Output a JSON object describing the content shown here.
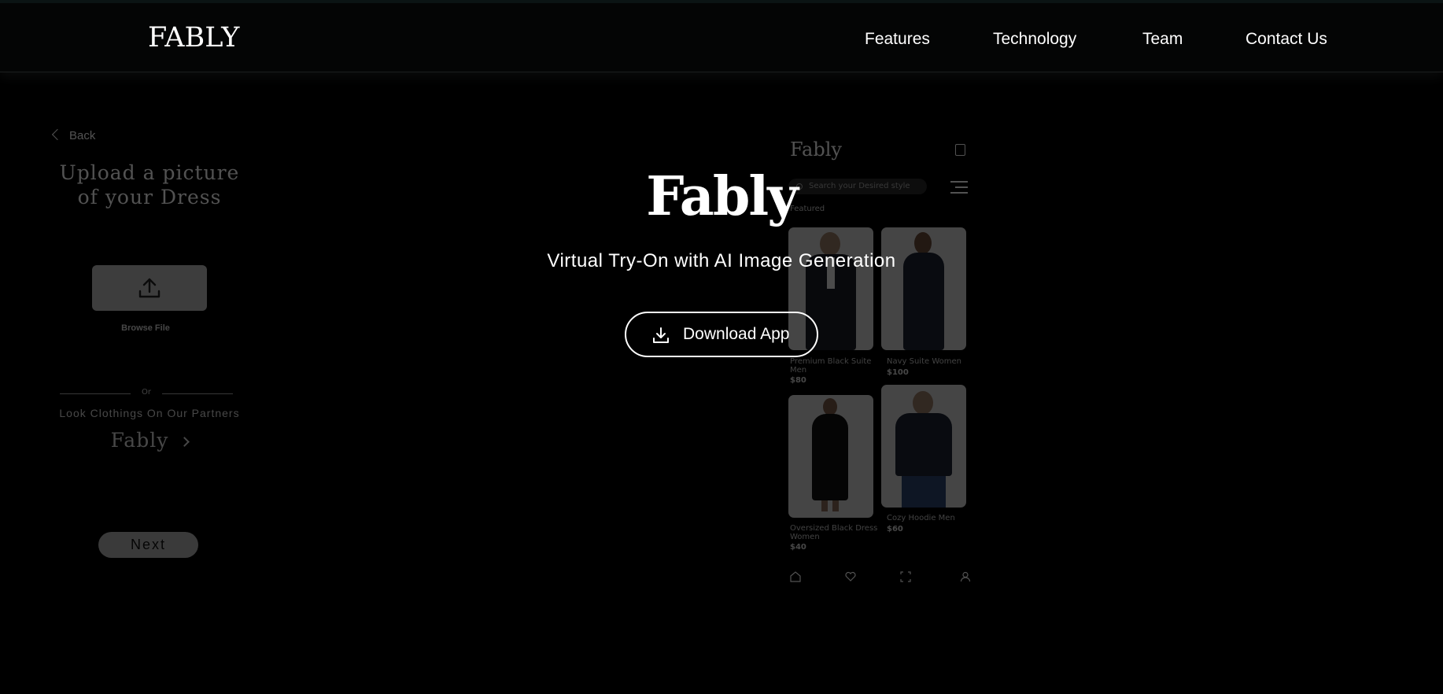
{
  "header": {
    "brand": "FABLY",
    "nav": [
      "Features",
      "Technology",
      "Team",
      "Contact Us"
    ]
  },
  "hero": {
    "logo": "Fably",
    "subtitle": "Virtual Try-On with AI Image Generation",
    "download_label": "Download App"
  },
  "upload_mockup": {
    "back_label": "Back",
    "title": "Upload a picture of your Dress",
    "browse_label": "Browse File",
    "or_label": "Or",
    "partners_label": "Look Clothings On Our Partners",
    "partner_name": "Fably",
    "next_label": "Next"
  },
  "phone_mockup": {
    "brand": "Fably",
    "search_placeholder": "Search your Desired style",
    "section_label": "Featured",
    "products": [
      {
        "name": "Premium Black Suite Men",
        "price": "$80"
      },
      {
        "name": "Navy Suite Women",
        "price": "$100"
      },
      {
        "name": "Oversized Black Dress Women",
        "price": "$40"
      },
      {
        "name": "Cozy Hoodie Men",
        "price": "$60"
      }
    ],
    "tabs": [
      "home-icon",
      "heart-icon",
      "scan-icon",
      "profile-icon"
    ]
  },
  "colors": {
    "background": "#000000",
    "header_bg": "#040505",
    "text": "#ffffff"
  }
}
